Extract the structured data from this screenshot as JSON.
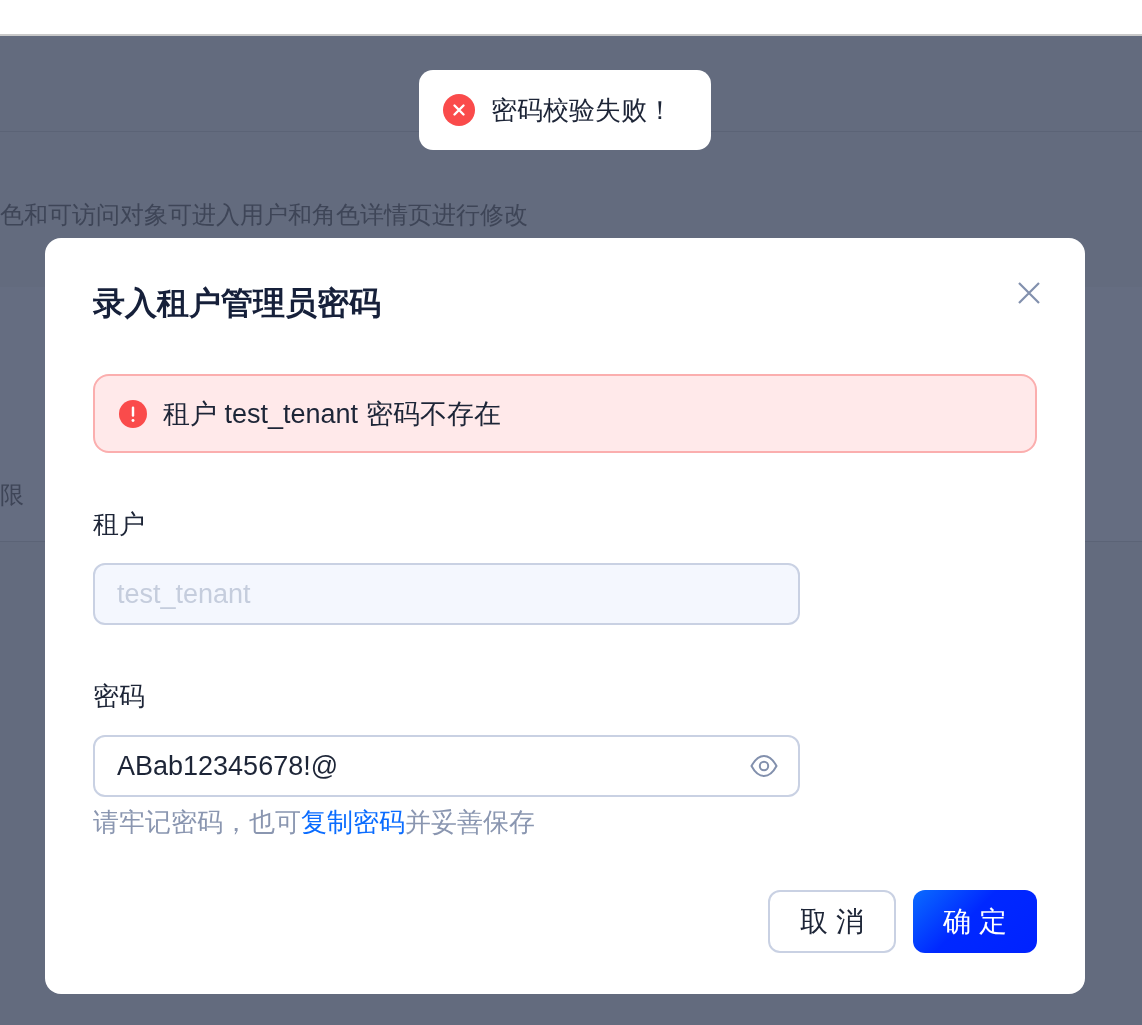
{
  "background": {
    "description": "色和可访问对象可进入用户和角色详情页进行修改",
    "column_header": "限"
  },
  "toast": {
    "kind": "error",
    "message": "密码校验失败！"
  },
  "dialog": {
    "title": "录入租户管理员密码",
    "alert": {
      "kind": "error",
      "message": "租户 test_tenant 密码不存在"
    },
    "fields": [
      {
        "label": "租户",
        "value": "test_tenant",
        "disabled": true
      },
      {
        "label": "密码",
        "value": "ABab12345678!@",
        "disabled": false,
        "revealed": true
      }
    ],
    "hint": {
      "text_before": "请牢记密码，也可",
      "link": "复制密码",
      "text_after": "并妥善保存"
    },
    "buttons": [
      {
        "label": "取 消",
        "kind": "secondary"
      },
      {
        "label": "确 定",
        "kind": "primary"
      }
    ]
  }
}
